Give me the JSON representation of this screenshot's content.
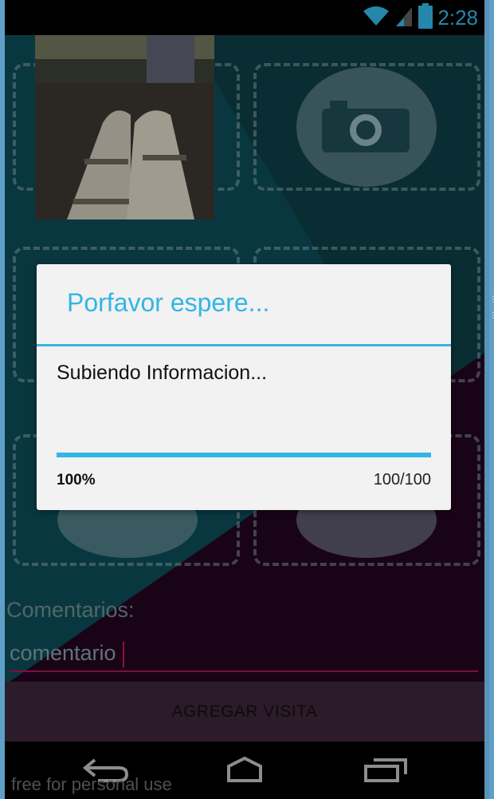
{
  "status_bar": {
    "time": "2:28",
    "icons": [
      "wifi-icon",
      "cell-signal-icon",
      "battery-icon"
    ]
  },
  "form": {
    "comments_label": "Comentarios:",
    "comments_value": "comentario",
    "add_visit_button": "AGREGAR VISITA",
    "photo_slots": [
      "photo-thumbnail",
      "camera-icon",
      "camera-icon",
      "camera-icon",
      "camera-icon",
      "camera-icon"
    ]
  },
  "dialog": {
    "title": "Porfavor espere...",
    "message": "Subiendo Informacion...",
    "progress_percent_text": "100%",
    "progress_count_text": "100/100",
    "progress_fraction": 1.0
  },
  "nav_bar": {
    "buttons": [
      "back-icon",
      "home-icon",
      "recents-icon"
    ]
  },
  "watermark": "free for personal use",
  "colors": {
    "accent": "#33b5e5",
    "comment_underline": "#a3174e",
    "dialog_bg": "#f2f2f2"
  }
}
